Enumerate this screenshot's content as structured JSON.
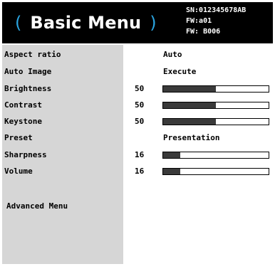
{
  "header": {
    "open_paren": "(",
    "title": "Basic Menu",
    "close_paren": ")",
    "sn": "SN:012345678AB",
    "fw1": "FW:a01",
    "fw2": "FW: B006"
  },
  "menu": {
    "items": [
      {
        "label": "Aspect ratio",
        "value": "Auto"
      },
      {
        "label": "Auto Image",
        "value": "Execute"
      },
      {
        "label": "Brightness",
        "number": "50",
        "level": 0.5
      },
      {
        "label": "Contrast",
        "number": "50",
        "level": 0.5
      },
      {
        "label": "Keystone",
        "number": "50",
        "level": 0.5
      },
      {
        "label": "Preset",
        "value": "Presentation"
      },
      {
        "label": "Sharpness",
        "number": "16",
        "level": 0.16
      },
      {
        "label": "Volume",
        "number": "16",
        "level": 0.16
      }
    ],
    "advanced_label": "Advanced Menu"
  }
}
